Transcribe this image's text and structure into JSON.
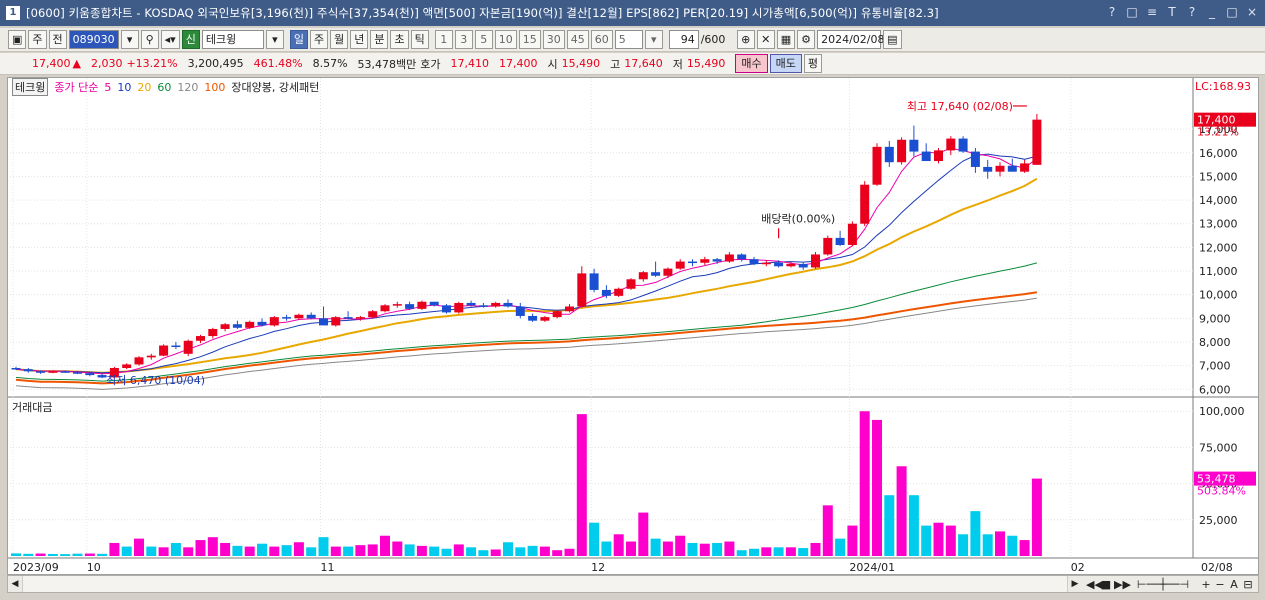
{
  "window": {
    "icon_label": "1",
    "title": "[0600] 키움종합차트 - KOSDAQ 외국인보유[3,196(천)] 주식수[37,354(천)] 액면[500] 자본금[190(억)] 결산[12월] EPS[862] PER[20.19] 시가총액[6,500(억)] 유통비율[82.3]",
    "controls": [
      "?",
      "□",
      "≡",
      "T",
      "?",
      "_",
      "□",
      "×"
    ]
  },
  "toolbar": {
    "period_selector": "주",
    "prev_label": "전",
    "stock_code": "089030",
    "credit_badge": "신",
    "stock_name": "테크윙",
    "period_tabs": [
      "일",
      "주",
      "월",
      "년",
      "분",
      "초",
      "틱"
    ],
    "period_selected": "일",
    "minute_options": [
      "1",
      "3",
      "5",
      "10",
      "15",
      "30",
      "45",
      "60"
    ],
    "custom_period": "5",
    "bar_count": "94",
    "bar_total": "/600",
    "date": "2024/02/08"
  },
  "quote": {
    "price": "17,400",
    "change_arrow": "▲",
    "change": "2,030",
    "change_pct": "+13.21%",
    "volume": "3,200,495",
    "volume_ratio": "461.48%",
    "turnover": "8.57%",
    "amount": "53,478백만",
    "quote_label": "호가",
    "ask": "17,410",
    "bid": "17,400",
    "open_label": "시",
    "open": "15,490",
    "high_label": "고",
    "high": "17,640",
    "low_label": "저",
    "low": "15,490",
    "buy_label": "매수",
    "sell_label": "매도",
    "eval_label": "평"
  },
  "legend": {
    "name": "테크윙",
    "ma_label": "종가 단순",
    "ma_periods": [
      "5",
      "10",
      "20",
      "60",
      "120",
      "100"
    ],
    "pattern": "장대양봉, 강세패턴"
  },
  "annotations": {
    "high": "최고 17,640 (02/08)",
    "low": "최저 6,470 (10/04)",
    "dividend": "배당락(0.00%)",
    "lc": "LC:168.93",
    "last_price": "17,400",
    "last_pct": "13.21%",
    "volume_last": "53,478",
    "volume_pct": "503.84%"
  },
  "colors": {
    "up": "#e8001c",
    "down": "#1a4fd1",
    "ma5": "#ee00aa",
    "ma10": "#1a3ab8",
    "ma20": "#e8a800",
    "ma60": "#0a8a3a",
    "ma120": "#ee5500",
    "ma100": "#888888",
    "vol_up": "#ff00cc",
    "vol_down": "#00ccee"
  },
  "volume_panel": {
    "label": "거래대금"
  },
  "chart_data": {
    "type": "candlestick",
    "price_axis_ticks": [
      "17,000",
      "16,000",
      "15,000",
      "14,000",
      "13,000",
      "12,000",
      "11,000",
      "10,000",
      "9,000",
      "8,000",
      "7,000",
      "6,000"
    ],
    "volume_axis_ticks": [
      "100,000",
      "75,000",
      "50,000",
      "25,000"
    ],
    "x_ticks": [
      "2023/09",
      "10",
      "11",
      "12",
      "2024/01",
      "02",
      "02/08"
    ],
    "ylim": [
      5800,
      18400
    ],
    "candles": [
      [
        6900,
        6950,
        6820,
        6850
      ],
      [
        6850,
        6900,
        6700,
        6760
      ],
      [
        6760,
        6800,
        6650,
        6700
      ],
      [
        6700,
        6800,
        6680,
        6760
      ],
      [
        6760,
        6800,
        6700,
        6720
      ],
      [
        6720,
        6780,
        6640,
        6680
      ],
      [
        6680,
        6700,
        6550,
        6600
      ],
      [
        6600,
        6650,
        6470,
        6500
      ],
      [
        6500,
        6950,
        6480,
        6900
      ],
      [
        6900,
        7100,
        6850,
        7050
      ],
      [
        7050,
        7400,
        7000,
        7350
      ],
      [
        7350,
        7500,
        7250,
        7420
      ],
      [
        7420,
        7900,
        7400,
        7850
      ],
      [
        7850,
        8000,
        7700,
        7800
      ],
      [
        7500,
        8100,
        7400,
        8050
      ],
      [
        8050,
        8300,
        7950,
        8250
      ],
      [
        8250,
        8600,
        8150,
        8550
      ],
      [
        8550,
        8800,
        8450,
        8750
      ],
      [
        8750,
        8900,
        8550,
        8600
      ],
      [
        8600,
        8900,
        8550,
        8850
      ],
      [
        8850,
        9000,
        8650,
        8700
      ],
      [
        8700,
        9100,
        8650,
        9050
      ],
      [
        9050,
        9150,
        8900,
        9000
      ],
      [
        9000,
        9200,
        8950,
        9150
      ],
      [
        9150,
        9250,
        8950,
        9000
      ],
      [
        9000,
        9500,
        8800,
        8700
      ],
      [
        8700,
        9100,
        8650,
        9050
      ],
      [
        9050,
        9300,
        8950,
        9000
      ],
      [
        9000,
        9100,
        8900,
        9050
      ],
      [
        9050,
        9350,
        9000,
        9300
      ],
      [
        9300,
        9600,
        9250,
        9550
      ],
      [
        9550,
        9700,
        9450,
        9600
      ],
      [
        9600,
        9700,
        9350,
        9400
      ],
      [
        9400,
        9750,
        9350,
        9700
      ],
      [
        9700,
        9700,
        9500,
        9550
      ],
      [
        9550,
        9600,
        9200,
        9250
      ],
      [
        9250,
        9700,
        9200,
        9650
      ],
      [
        9650,
        9750,
        9500,
        9550
      ],
      [
        9550,
        9650,
        9450,
        9500
      ],
      [
        9500,
        9700,
        9450,
        9650
      ],
      [
        9650,
        9800,
        9450,
        9500
      ],
      [
        9500,
        9650,
        9000,
        9100
      ],
      [
        9100,
        9200,
        8850,
        8900
      ],
      [
        8900,
        9100,
        8850,
        9050
      ],
      [
        9050,
        9350,
        9000,
        9300
      ],
      [
        9300,
        9600,
        9250,
        9500
      ],
      [
        9500,
        11200,
        9450,
        10900
      ],
      [
        10900,
        11100,
        10100,
        10200
      ],
      [
        10200,
        10400,
        9850,
        9950
      ],
      [
        9950,
        10300,
        9900,
        10250
      ],
      [
        10250,
        10700,
        10200,
        10650
      ],
      [
        10650,
        11000,
        10550,
        10950
      ],
      [
        10950,
        11400,
        10750,
        10800
      ],
      [
        10800,
        11150,
        10700,
        11100
      ],
      [
        11100,
        11500,
        11050,
        11400
      ],
      [
        11400,
        11500,
        11200,
        11350
      ],
      [
        11350,
        11600,
        11250,
        11500
      ],
      [
        11500,
        11550,
        11300,
        11400
      ],
      [
        11400,
        11800,
        11350,
        11700
      ],
      [
        11700,
        11750,
        11400,
        11500
      ],
      [
        11500,
        11600,
        11250,
        11300
      ],
      [
        11300,
        11450,
        11200,
        11350
      ],
      [
        11350,
        11450,
        11150,
        11200
      ],
      [
        11200,
        11400,
        11150,
        11300
      ],
      [
        11300,
        11350,
        11050,
        11150
      ],
      [
        11150,
        11800,
        11100,
        11700
      ],
      [
        11700,
        12500,
        11650,
        12400
      ],
      [
        12400,
        12700,
        12050,
        12100
      ],
      [
        12100,
        13100,
        12050,
        13000
      ],
      [
        13000,
        14800,
        12900,
        14650
      ],
      [
        14650,
        16400,
        14600,
        16250
      ],
      [
        16250,
        16500,
        15400,
        15600
      ],
      [
        15600,
        16650,
        15500,
        16550
      ],
      [
        16550,
        17150,
        15850,
        16050
      ],
      [
        16050,
        16400,
        15700,
        15650
      ],
      [
        15650,
        16200,
        15550,
        16100
      ],
      [
        16100,
        16700,
        15900,
        16600
      ],
      [
        16600,
        16700,
        16000,
        16050
      ],
      [
        16050,
        16200,
        15150,
        15400
      ],
      [
        15400,
        15700,
        14900,
        15200
      ],
      [
        15200,
        15600,
        15000,
        15450
      ],
      [
        15450,
        15750,
        15200,
        15200
      ],
      [
        15200,
        15700,
        15150,
        15550
      ],
      [
        15490,
        17640,
        15490,
        17400
      ]
    ],
    "volumes": [
      1800,
      1500,
      1700,
      1400,
      1300,
      1600,
      1700,
      1500,
      9000,
      6500,
      12000,
      6500,
      6000,
      9000,
      6000,
      11000,
      13000,
      9000,
      7000,
      6500,
      8500,
      6500,
      7500,
      9500,
      6000,
      13000,
      6500,
      6500,
      7500,
      8000,
      14000,
      10000,
      8000,
      7000,
      6500,
      5000,
      8000,
      6000,
      4000,
      4500,
      9500,
      6000,
      7000,
      6500,
      4000,
      5000,
      98000,
      23000,
      10000,
      15000,
      10000,
      30000,
      12000,
      10000,
      14000,
      9000,
      8500,
      9000,
      10000,
      4000,
      5000,
      6000,
      6000,
      6000,
      5500,
      9000,
      35000,
      12000,
      21000,
      100000,
      94000,
      42000,
      62000,
      42000,
      21000,
      23000,
      21000,
      15000,
      31000,
      15000,
      17000,
      14000,
      11000,
      53478
    ],
    "vol_up": [
      false,
      false,
      true,
      false,
      false,
      false,
      true,
      false,
      true,
      false,
      true,
      false,
      true,
      false,
      true,
      true,
      true,
      true,
      false,
      true,
      false,
      true,
      false,
      true,
      false,
      false,
      true,
      false,
      true,
      true,
      true,
      true,
      false,
      true,
      false,
      false,
      true,
      false,
      false,
      true,
      false,
      false,
      false,
      true,
      true,
      true,
      true,
      false,
      false,
      true,
      true,
      true,
      false,
      true,
      true,
      false,
      true,
      false,
      true,
      false,
      false,
      true,
      false,
      true,
      false,
      true,
      true,
      false,
      true,
      true,
      true,
      false,
      true,
      false,
      false,
      true,
      true,
      false,
      false,
      false,
      true,
      false,
      true,
      true
    ]
  }
}
